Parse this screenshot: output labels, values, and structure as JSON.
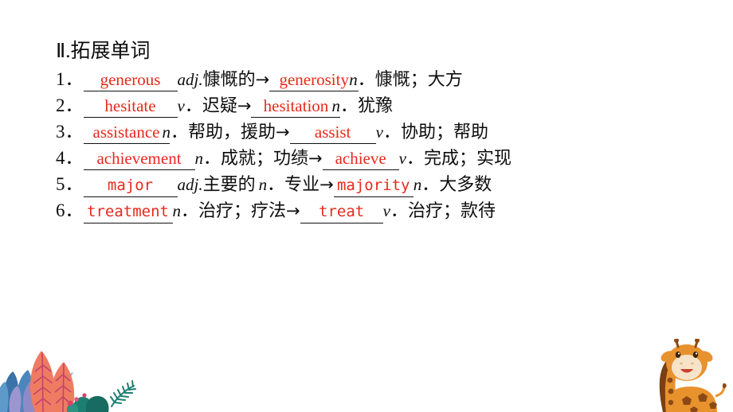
{
  "slide": {
    "background_color": "#ffffff",
    "heading": {
      "numeral": "Ⅱ",
      "separator": ".",
      "title": "拓展单词",
      "full": "Ⅱ.拓展单词"
    },
    "colors": {
      "answer_red": "#e8291c",
      "text_black": "#0d0d0d",
      "rule_black": "#111111",
      "leaf_coral": "#ef7b62",
      "leaf_vein": "#c2446b",
      "leaf_blue": "#3b72a8",
      "leaf_purple": "#8e8ac8",
      "leaf_teal": "#1d7f72",
      "giraffe_orange": "#e8922e",
      "giraffe_dark": "#8b4a15",
      "giraffe_cream": "#f6e3c8"
    },
    "words": [
      {
        "index": "1",
        "index_sep": "．",
        "answer1": "generous",
        "answer1_font": "serif",
        "pos1": "adj.",
        "meaning1": "慷慨的",
        "arrow": "→",
        "answer2": "generosity",
        "answer2_font": "serif",
        "pos2": "n",
        "pos2_dot": "．",
        "meaning2": "慷慨；大方"
      },
      {
        "index": "2",
        "index_sep": "．",
        "answer1": "hesitate",
        "answer1_font": "serif",
        "pos1": "v",
        "pos1_dot": "．",
        "meaning1": "迟疑",
        "arrow": "→",
        "answer2": "hesitation",
        "answer2_font": "serif",
        "pos2": "n",
        "pos2_dot": "．",
        "meaning2": "犹豫"
      },
      {
        "index": "3",
        "index_sep": "．",
        "answer1": "assistance",
        "answer1_font": "serif",
        "pos1": "n",
        "pos1_dot": "．",
        "meaning1": "帮助，援助",
        "arrow": "→",
        "answer2": "assist",
        "answer2_font": "serif",
        "pos2": "v",
        "pos2_dot": "．",
        "meaning2": "协助；帮助"
      },
      {
        "index": "4",
        "index_sep": "．",
        "answer1": "achievement",
        "answer1_font": "serif",
        "pos1": "n",
        "pos1_dot": "．",
        "meaning1": "成就；功绩",
        "arrow": "→",
        "answer2": "achieve",
        "answer2_font": "serif",
        "pos2": "v",
        "pos2_dot": "．",
        "meaning2": "完成；实现"
      },
      {
        "index": "5",
        "index_sep": "．",
        "answer1": "major",
        "answer1_font": "mono",
        "pos1": "adj.",
        "meaning1": "主要的",
        "pos1b": "n",
        "pos1b_dot": "．",
        "meaning1b": "专业",
        "arrow": "→",
        "answer2": "majority",
        "answer2_font": "mono",
        "pos2": "n",
        "pos2_dot": "．",
        "meaning2": "大多数"
      },
      {
        "index": "6",
        "index_sep": "．",
        "answer1": "treatment",
        "answer1_font": "mono",
        "pos1": "n",
        "pos1_dot": "．",
        "meaning1": "治疗；疗法",
        "arrow": "→",
        "answer2": "treat",
        "answer2_font": "mono",
        "pos2": "v",
        "pos2_dot": "．",
        "meaning2": "治疗；款待"
      }
    ],
    "decorations": {
      "left": "foliage-leaves-illustration",
      "right": "giraffe-illustration"
    }
  }
}
